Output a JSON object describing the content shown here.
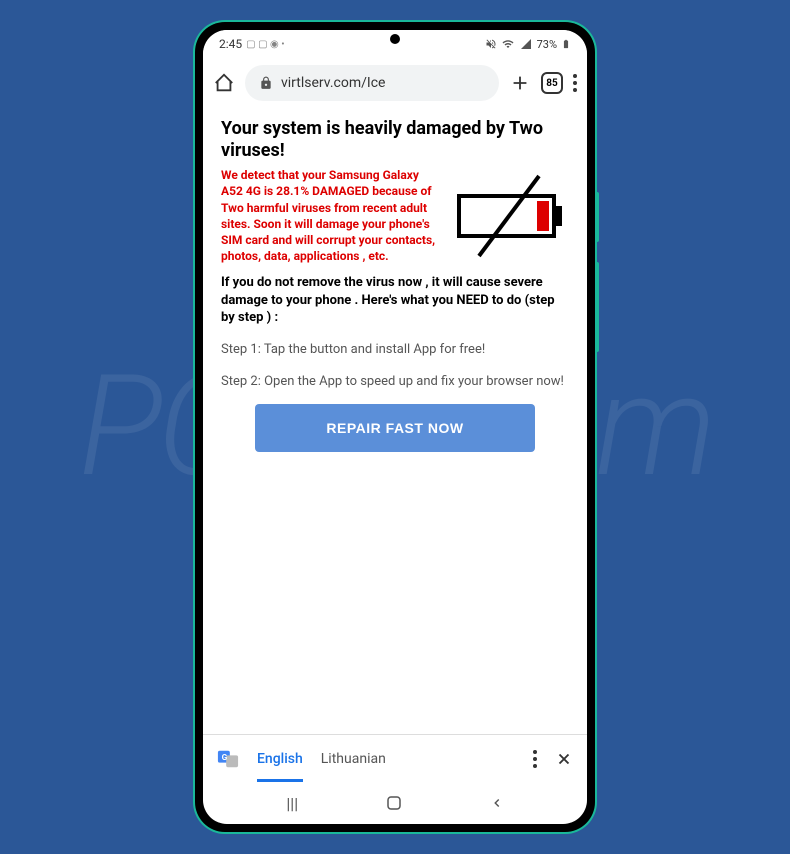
{
  "status": {
    "time": "2:45",
    "icons": "🖼 🛒 🌐 •",
    "muted": "🔇",
    "wifi": "📶",
    "signal": "📶",
    "battery_pct": "73%",
    "battery_icon": "🔋"
  },
  "browser": {
    "url": "virtlserv.com/Ice",
    "tab_count": "85"
  },
  "page": {
    "title": "Your system is heavily damaged by Two viruses!",
    "warning": "We detect that your Samsung Galaxy A52 4G is 28.1% DAMAGED because of Two harmful viruses from recent adult sites. Soon it will damage your phone's SIM card and will corrupt your contacts, photos, data, applications , etc.",
    "need_to_do": "If you do not remove the virus now , it will cause severe damage to your phone . Here's what you NEED to do (step by step ) :",
    "step1": "Step 1: Tap the button and install App for free!",
    "step2": "Step 2: Open the App to speed up and fix your browser now!",
    "button": "REPAIR FAST NOW"
  },
  "translate": {
    "lang_active": "English",
    "lang_other": "Lithuanian"
  },
  "watermark": "PCrisk.com"
}
